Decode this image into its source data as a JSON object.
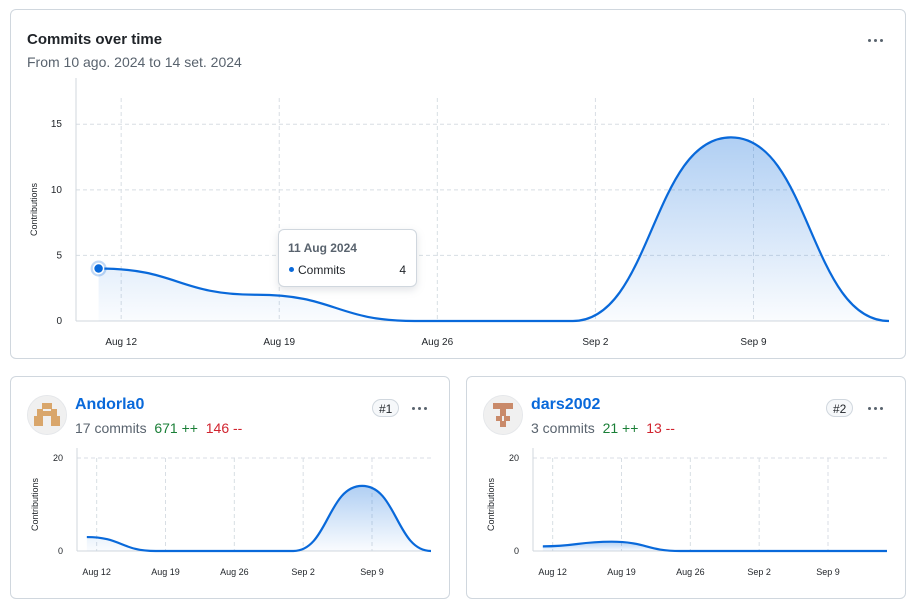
{
  "overview": {
    "title": "Commits over time",
    "subtitle": "From 10 ago. 2024 to 14 set. 2024",
    "menu_icon": "kebab-horizontal-icon",
    "tooltip": {
      "date": "11 Aug 2024",
      "series_label": "Commits",
      "value": "4"
    }
  },
  "contributors": [
    {
      "name": "Andorla0",
      "commits_text": "17 commits",
      "additions": "671 ++",
      "deletions": "146 --",
      "rank": "#1",
      "avatar_icon": "identicon-avatar-icon",
      "avatar_color": "#d9a66b"
    },
    {
      "name": "dars2002",
      "commits_text": "3 commits",
      "additions": "21 ++",
      "deletions": "13 --",
      "rank": "#2",
      "avatar_icon": "identicon-avatar-icon",
      "avatar_color": "#c98a6a"
    }
  ],
  "colors": {
    "accent": "#0969da",
    "additions": "#1a7f37",
    "deletions": "#d1242f"
  },
  "chart_data": [
    {
      "type": "area",
      "title": "Commits over time",
      "ylabel": "Contributions",
      "xlabel": "",
      "x_ticks": [
        "Aug 12",
        "Aug 19",
        "Aug 26",
        "Sep 2",
        "Sep 9"
      ],
      "y_ticks": [
        "0",
        "5",
        "10",
        "15"
      ],
      "ylim": [
        0,
        17
      ],
      "grid": true,
      "series": [
        {
          "name": "Commits",
          "points": [
            [
              "2024-08-11",
              4
            ],
            [
              "2024-08-18",
              2
            ],
            [
              "2024-08-25",
              0
            ],
            [
              "2024-09-01",
              0
            ],
            [
              "2024-09-08",
              14
            ],
            [
              "2024-09-15",
              0
            ]
          ]
        }
      ]
    },
    {
      "type": "area",
      "title": "Andorla0",
      "ylabel": "Contributions",
      "x_ticks": [
        "Aug 12",
        "Aug 19",
        "Aug 26",
        "Sep 2",
        "Sep 9"
      ],
      "y_ticks": [
        "0",
        "20"
      ],
      "ylim": [
        0,
        20
      ],
      "grid": true,
      "series": [
        {
          "name": "Commits",
          "points": [
            [
              "2024-08-11",
              3
            ],
            [
              "2024-08-18",
              0
            ],
            [
              "2024-08-25",
              0
            ],
            [
              "2024-09-01",
              0
            ],
            [
              "2024-09-08",
              14
            ],
            [
              "2024-09-15",
              0
            ]
          ]
        }
      ]
    },
    {
      "type": "area",
      "title": "dars2002",
      "ylabel": "Contributions",
      "x_ticks": [
        "Aug 12",
        "Aug 19",
        "Aug 26",
        "Sep 2",
        "Sep 9"
      ],
      "y_ticks": [
        "0",
        "20"
      ],
      "ylim": [
        0,
        20
      ],
      "grid": true,
      "series": [
        {
          "name": "Commits",
          "points": [
            [
              "2024-08-11",
              1
            ],
            [
              "2024-08-18",
              2
            ],
            [
              "2024-08-25",
              0
            ],
            [
              "2024-09-01",
              0
            ],
            [
              "2024-09-08",
              0
            ],
            [
              "2024-09-15",
              0
            ]
          ]
        }
      ]
    }
  ]
}
